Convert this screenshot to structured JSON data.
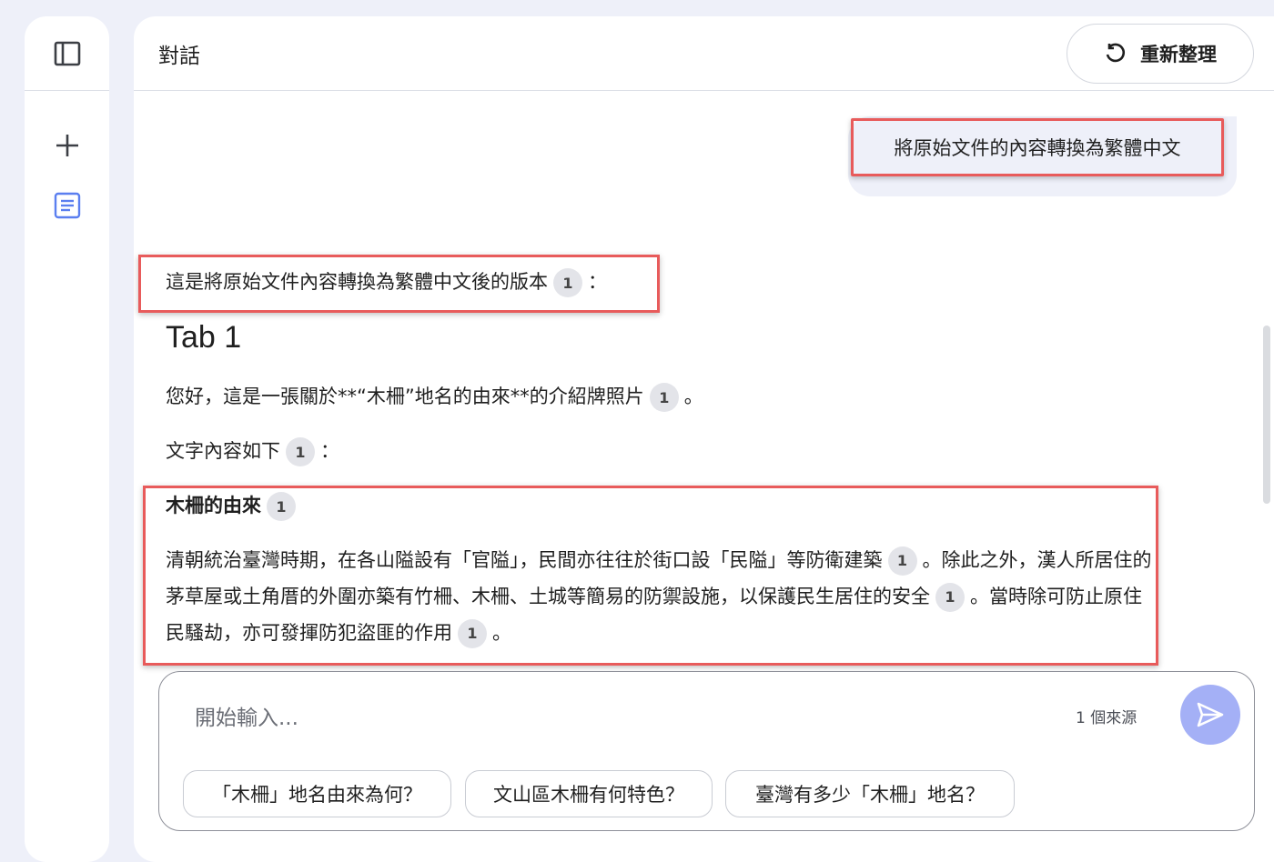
{
  "header": {
    "title": "對話",
    "refresh_label": "重新整理"
  },
  "user_message": "將原始文件的內容轉換為繁體中文",
  "response": {
    "intro": "這是將原始文件內容轉換為繁體中文後的版本",
    "intro_suffix": "：",
    "heading": "Tab 1",
    "line1": "您好，這是一張關於**“木柵”地名的由來**的介紹牌照片",
    "line1_suffix": "。",
    "line2": "文字內容如下",
    "line2_suffix": "：",
    "subheading": "木柵的由來",
    "para_a": "清朝統治臺灣時期，在各山隘設有「官隘」，民間亦往往於街口設「民隘」等防衛建築",
    "para_b": "。除此之外，漢人所居住的茅草屋或土角厝的外圍亦築有竹柵、木柵、土城等簡易的防禦設施，以保護民生居住的安全",
    "para_c": "。當時除可防止原住民騷劫，亦可發揮防犯盜匪的作用",
    "para_d": "。",
    "citation": "1"
  },
  "input": {
    "placeholder": "開始輸入...",
    "source_count": "1 個來源"
  },
  "suggestions": [
    "「木柵」地名由來為何？",
    "文山區木柵有何特色？",
    "臺灣有多少「木柵」地名？"
  ],
  "colors": {
    "background": "#eef0f9",
    "highlight_border": "#e85b5b",
    "send_button": "#a4b0f6",
    "citation_bg": "#e3e4e9",
    "notes_icon": "#5b7ff0"
  },
  "icons": {
    "sidebar_toggle": "sidebar-panel-icon",
    "new": "plus-icon",
    "notes": "document-icon",
    "refresh": "refresh-icon",
    "send": "send-icon"
  }
}
